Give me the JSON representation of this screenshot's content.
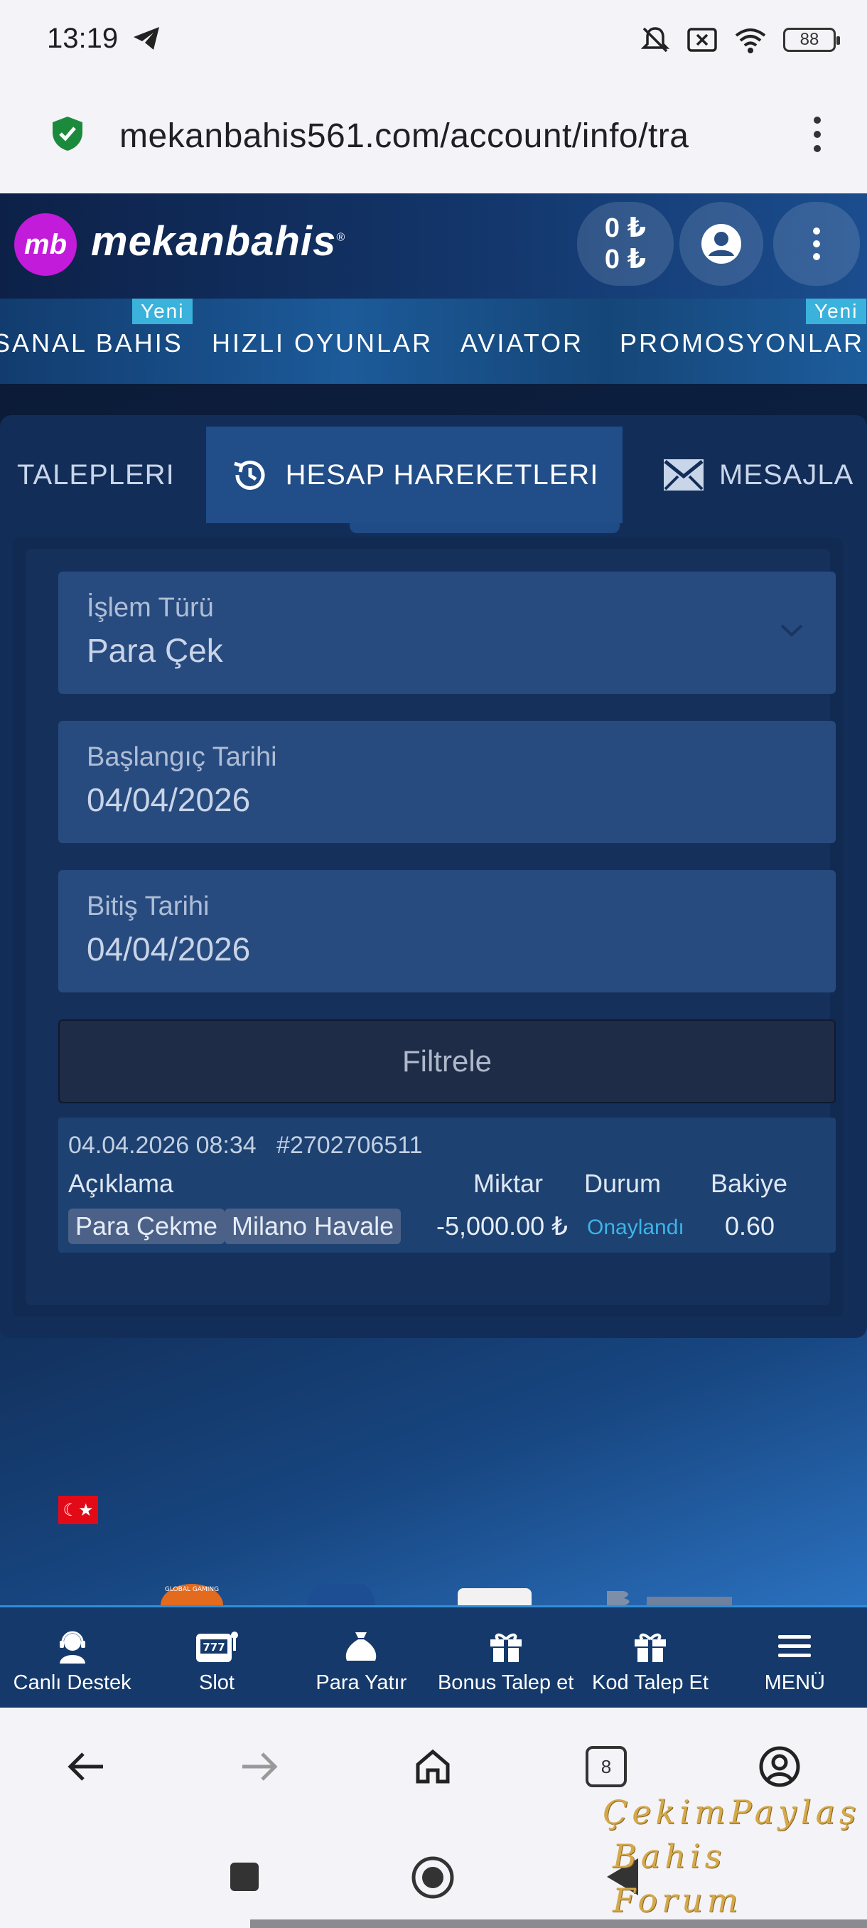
{
  "status_bar": {
    "time": "13:19",
    "battery": "88"
  },
  "browser": {
    "url": "mekanbahis561.com/account/info/tra"
  },
  "header": {
    "logo_badge": "mb",
    "logo_text": "mekanbahis",
    "balance_line1": "0 ₺",
    "balance_line2": "0 ₺"
  },
  "nav": {
    "items": [
      "SANAL BAHIS",
      "HIZLI OYUNLAR",
      "AVIATOR",
      "PROMOSYONLAR"
    ],
    "badge": "Yeni"
  },
  "tabs": [
    {
      "label": "TALEPLERI"
    },
    {
      "label": "HESAP HAREKETLERI"
    },
    {
      "label": "MESAJLA"
    }
  ],
  "filters": {
    "type_label": "İşlem Türü",
    "type_value": "Para Çek",
    "start_label": "Başlangıç Tarihi",
    "start_value": "04/04/2026",
    "end_label": "Bitiş Tarihi",
    "end_value": "04/04/2026",
    "filter_button": "Filtrele"
  },
  "transaction": {
    "datetime": "04.04.2026 08:34",
    "id": "#2702706511",
    "col_desc": "Açıklama",
    "col_amount": "Miktar",
    "col_status": "Durum",
    "col_balance": "Bakiye",
    "tag1": "Para Çekme",
    "tag2": "Milano Havale",
    "amount": "-5,000.00 ₺",
    "status": "Onaylandı",
    "balance": "0.60"
  },
  "bottom_nav": [
    {
      "label": "Canlı Destek",
      "icon": "support-agent-icon"
    },
    {
      "label": "Slot",
      "icon": "slot-machine-icon"
    },
    {
      "label": "Para Yatır",
      "icon": "money-bag-icon"
    },
    {
      "label": "Bonus Talep et",
      "icon": "gift-icon"
    },
    {
      "label": "Kod Talep Et",
      "icon": "gift-icon"
    },
    {
      "label": "MENÜ",
      "icon": "hamburger-icon"
    }
  ],
  "watermark": {
    "line1": "ÇekimPaylaş",
    "line2": "Bahis Forum"
  },
  "colors": {
    "accent": "#3ab2dc",
    "status_approved": "#3db4e8",
    "logo": "#c21bd9"
  }
}
